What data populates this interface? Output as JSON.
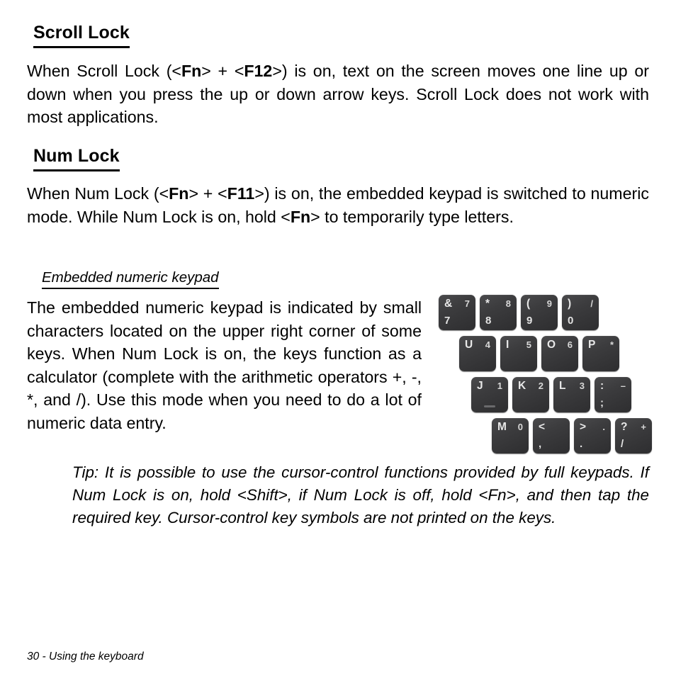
{
  "document": {
    "footer": "30 - Using the keyboard"
  },
  "sections": {
    "scroll_lock": {
      "heading": "Scroll Lock",
      "body_prefix": "When Scroll Lock (<",
      "body_key1": "Fn",
      "body_mid": "> + <",
      "body_key2": "F12",
      "body_suffix": ">) is on, text on the screen moves one line up or down when you press the up or down arrow keys. Scroll Lock does not work with most applications."
    },
    "num_lock": {
      "heading": "Num Lock",
      "body_prefix": "When Num Lock (<",
      "body_key1": "Fn",
      "body_mid": "> + <",
      "body_key2": "F11",
      "body_mid2": ">) is on, the embedded keypad is switched to numeric mode. While Num Lock is on, hold <",
      "body_key3": "Fn",
      "body_suffix": "> to temporarily type letters."
    },
    "embedded_keypad": {
      "heading": "Embedded numeric keypad",
      "body": "The embedded numeric keypad is indicated by small characters located on the upper right corner of some keys. When Num Lock is on, the keys function as a calculator (complete with the arithmetic operators +, -, *, and /). Use this mode when you need to do a lot of numeric data entry.",
      "tip": "Tip: It is possible to use the cursor-control functions provided by full keypads. If Num Lock is on, hold <Shift>, if Num Lock is off, hold <Fn>, and then tap the required key. Cursor-control key symbols are not printed on the keys."
    }
  },
  "keypad_figure": {
    "rows": [
      {
        "offset": 0,
        "keys": [
          {
            "main": "&",
            "alt": "7",
            "sub": "7",
            "bump": false
          },
          {
            "main": "*",
            "alt": "8",
            "sub": "8",
            "bump": false
          },
          {
            "main": "(",
            "alt": "9",
            "sub": "9",
            "bump": false
          },
          {
            "main": ")",
            "alt": "/",
            "sub": "0",
            "bump": false
          }
        ]
      },
      {
        "offset": 29,
        "keys": [
          {
            "main": "U",
            "alt": "4",
            "sub": "",
            "bump": false
          },
          {
            "main": "I",
            "alt": "5",
            "sub": "",
            "bump": false
          },
          {
            "main": "O",
            "alt": "6",
            "sub": "",
            "bump": false
          },
          {
            "main": "P",
            "alt": "*",
            "sub": "",
            "bump": false
          }
        ]
      },
      {
        "offset": 46,
        "keys": [
          {
            "main": "J",
            "alt": "1",
            "sub": "",
            "bump": true
          },
          {
            "main": "K",
            "alt": "2",
            "sub": "",
            "bump": false
          },
          {
            "main": "L",
            "alt": "3",
            "sub": "",
            "bump": false
          },
          {
            "main": ":",
            "alt": "–",
            "sub": ";",
            "bump": false
          }
        ]
      },
      {
        "offset": 75,
        "keys": [
          {
            "main": "M",
            "alt": "0",
            "sub": "",
            "bump": false
          },
          {
            "main": "<",
            "alt": "",
            "sub": ",",
            "bump": false
          },
          {
            "main": ">",
            "alt": ".",
            "sub": ".",
            "bump": false
          },
          {
            "main": "?",
            "alt": "+",
            "sub": "/",
            "bump": false
          }
        ]
      }
    ],
    "key_color": "#3a3a3c",
    "legend_color": "#e8e8e8"
  }
}
